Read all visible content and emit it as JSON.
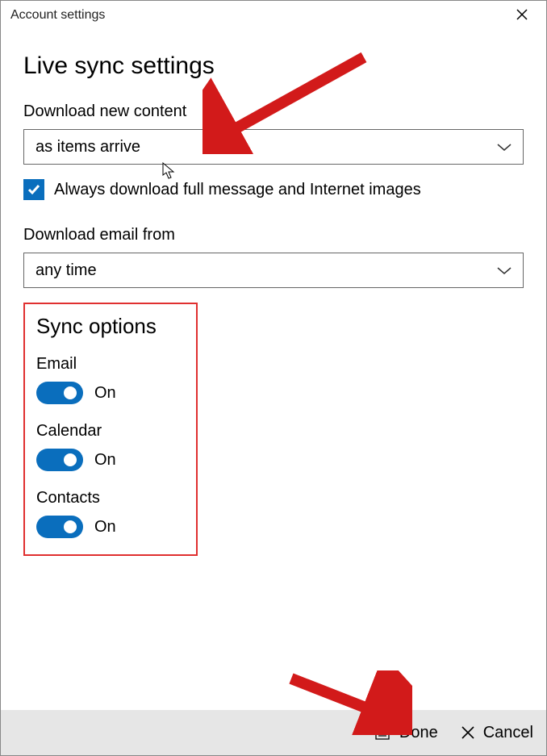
{
  "window": {
    "title": "Account settings"
  },
  "heading": "Live sync settings",
  "download_new_content": {
    "label": "Download new content",
    "selected": "as items arrive"
  },
  "full_message_checkbox": {
    "checked": true,
    "label": "Always download full message and Internet images"
  },
  "download_email_from": {
    "label": "Download email from",
    "selected": "any time"
  },
  "sync_options": {
    "heading": "Sync options",
    "items": [
      {
        "label": "Email",
        "state": "On",
        "on": true
      },
      {
        "label": "Calendar",
        "state": "On",
        "on": true
      },
      {
        "label": "Contacts",
        "state": "On",
        "on": true
      }
    ]
  },
  "footer": {
    "done": "Done",
    "cancel": "Cancel"
  },
  "colors": {
    "accent": "#0a6ebd",
    "annotation": "#e03030"
  }
}
